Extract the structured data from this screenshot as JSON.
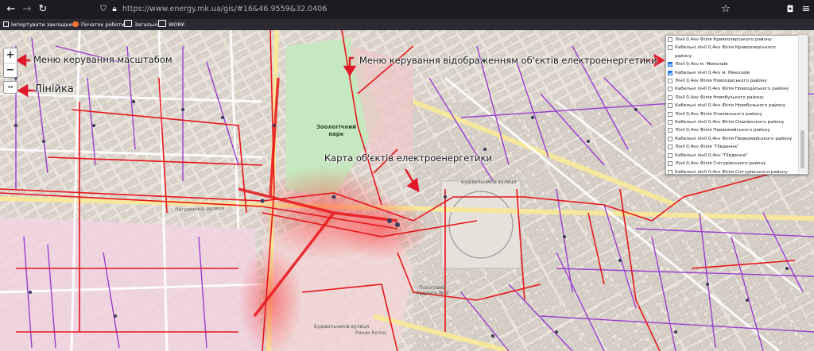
{
  "browser": {
    "url_domain": "https://www.energy.mk.ua",
    "url_path": "/gis/#16&46.9559&32.0406"
  },
  "bookmarks": [
    {
      "label": "Імпортувати закладки...",
      "icon": "import-icon"
    },
    {
      "label": "Початок роботи",
      "icon": "firefox-icon"
    },
    {
      "label": "Загальні",
      "icon": "folder-icon"
    },
    {
      "label": "WORK",
      "icon": "folder-icon"
    }
  ],
  "zoom": {
    "plus": "+",
    "minus": "−"
  },
  "ruler": {
    "label": "↔"
  },
  "annotations": {
    "zoom_menu": "Меню керування масштабом",
    "ruler": "Лінійка",
    "layers_menu": "Меню керування відображенням об'єктів електроенергетики",
    "map": "Карта об'єктів електроенергетики"
  },
  "layers": [
    {
      "label": "Лінії 0,4кv Філія Кривоозерського району",
      "checked": false
    },
    {
      "label": "Кабельні лінії 0,4кv Філія Кривоозерського",
      "checked": false
    },
    {
      "label": "району",
      "checked": null
    },
    {
      "label": "Лінії 0,4кv м. Миколаїв",
      "checked": true
    },
    {
      "label": "Кабельні лінії 0,4кv м. Миколаїв",
      "checked": true
    },
    {
      "label": "Лінії 0,4кv Філія Новоодеського району",
      "checked": false
    },
    {
      "label": "Кабельні лінії 0,4кv Філія Новоодеського району",
      "checked": false
    },
    {
      "label": "Лінії 0,4кv Філія Новобузького району",
      "checked": false
    },
    {
      "label": "Кабельні лінії 0,4кv Філія Новобузького району",
      "checked": false
    },
    {
      "label": "Лінії 0,4кv Філія Очаківського району",
      "checked": false
    },
    {
      "label": "Кабельні лінії 0,4кv Філія Очаківського району",
      "checked": false
    },
    {
      "label": "Лінії 0,4кv Філія Первомайського району",
      "checked": false
    },
    {
      "label": "Кабельні лінії 0,4кv Філія Первомайського району",
      "checked": false
    },
    {
      "label": "Лінії 0,4кv Філія \"Південна\"",
      "checked": false
    },
    {
      "label": "Кабельні лінії 0,4кv \"Південна\"",
      "checked": false
    },
    {
      "label": "Лінії 0,4кv Філія Снігурівського району",
      "checked": false
    },
    {
      "label": "Кабельні лінії 0,4кv Філія Снігурівського району",
      "checked": false
    }
  ],
  "map_labels": {
    "zoo": "Зоологічний парк",
    "street_1": "Погранична вулиця",
    "street_2": "Будівельників вулиця",
    "street_3": "Будівельників вулиця",
    "hospital": "Пологовий будинок № 2",
    "market": "Ринок Колос"
  },
  "colors": {
    "lines": "#e8151b",
    "cables": "#9a3ed0",
    "nodes": "#3a3a5a",
    "park": "#c6e8c0",
    "annot_arrow": "#e0192a",
    "checkbox_on": "#1a73e8"
  }
}
